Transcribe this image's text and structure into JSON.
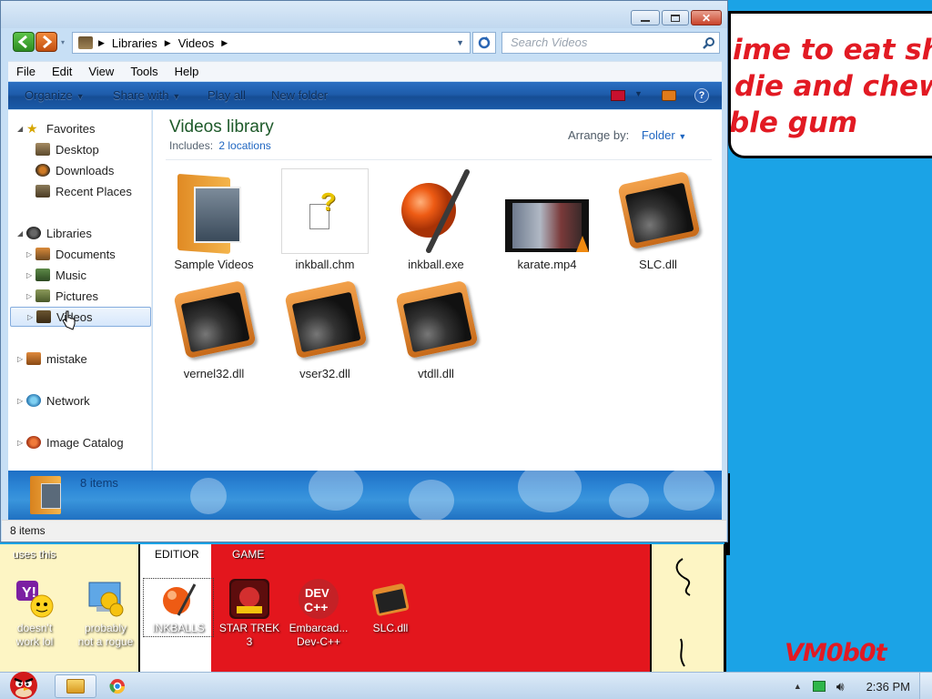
{
  "window": {
    "address_segments": [
      "Libraries",
      "Videos"
    ],
    "search_placeholder": "Search Videos",
    "menu": [
      "File",
      "Edit",
      "View",
      "Tools",
      "Help"
    ],
    "toolbar": {
      "organize": "Organize",
      "share_with": "Share with",
      "play_all": "Play all",
      "new_folder": "New folder"
    }
  },
  "navpane": {
    "favorites": "Favorites",
    "desktop": "Desktop",
    "downloads": "Downloads",
    "recent_places": "Recent Places",
    "libraries": "Libraries",
    "documents": "Documents",
    "music": "Music",
    "pictures": "Pictures",
    "videos": "Videos",
    "mistake": "mistake",
    "network": "Network",
    "image_catalog": "Image Catalog"
  },
  "content": {
    "title": "Videos library",
    "includes_label": "Includes:",
    "includes_link": "2 locations",
    "arrange_label": "Arrange by:",
    "arrange_value": "Folder",
    "files": [
      {
        "name": "Sample Videos",
        "icon": "folder-icon"
      },
      {
        "name": "inkball.chm",
        "icon": "help-file-icon"
      },
      {
        "name": "inkball.exe",
        "icon": "inkball-icon"
      },
      {
        "name": "karate.mp4",
        "icon": "video-icon"
      },
      {
        "name": "SLC.dll",
        "icon": "dll-icon"
      },
      {
        "name": "vernel32.dll",
        "icon": "dll-icon"
      },
      {
        "name": "vser32.dll",
        "icon": "dll-icon"
      },
      {
        "name": "vtdll.dll",
        "icon": "dll-icon"
      }
    ]
  },
  "details_count": "8 items",
  "status_text": "8 items",
  "desktop": {
    "note_lines": [
      "ime to eat shit",
      "die and chew",
      "ble gum"
    ],
    "label_uses_this": "uses this",
    "label_editor": "EDITIOR",
    "label_game": "GAME",
    "signature": "VM0b0t",
    "icons": [
      {
        "label1": "doesn't",
        "label2": "work lol"
      },
      {
        "label1": "probably",
        "label2": "not a rogue"
      },
      {
        "label1": "INKBALLS",
        "label2": ""
      },
      {
        "label1": "STAR TREK",
        "label2": "3"
      },
      {
        "label1": "Embarcad...",
        "label2": "Dev-C++"
      },
      {
        "label1": "SLC.dll",
        "label2": ""
      }
    ]
  },
  "taskbar": {
    "clock": "2:36 PM"
  }
}
